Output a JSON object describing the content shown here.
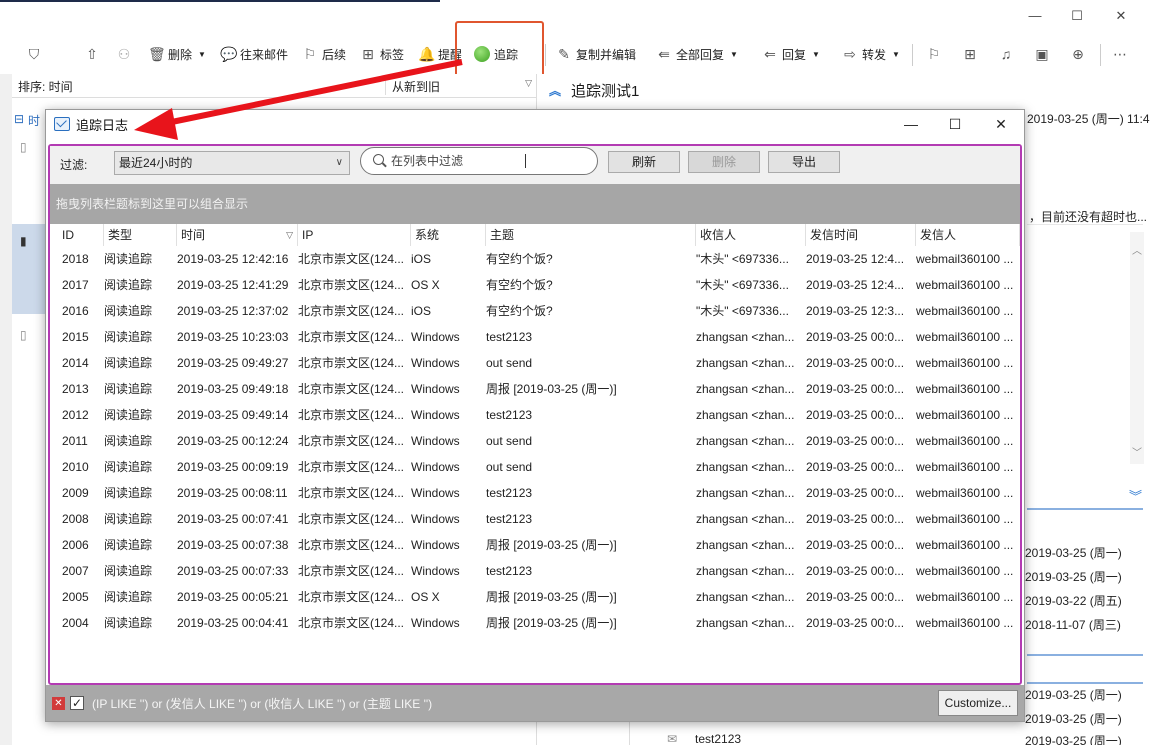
{
  "window": {
    "minimize": "—",
    "maximize": "☐",
    "close": "✕"
  },
  "toolbar": {
    "delete": "删除",
    "correspondence": "往来邮件",
    "followup": "后续",
    "tags": "标签",
    "remind": "提醒",
    "track": "追踪",
    "copy_edit": "复制并编辑",
    "reply_all": "全部回复",
    "reply": "回复",
    "forward": "转发"
  },
  "list": {
    "sort_label": "排序: 时间",
    "order_label": "从新到旧",
    "group_label": "时"
  },
  "preview": {
    "title": "追踪测试1",
    "date": "2019-03-25 (周一) 11:49",
    "snippet": "，目前还没有超时也...",
    "items": [
      {
        "date": "2019-03-25 (周一)"
      },
      {
        "date": "2019-03-25 (周一)"
      },
      {
        "date": "2019-03-22 (周五)"
      },
      {
        "date": "2018-11-07 (周三)"
      }
    ],
    "items2": [
      {
        "date": "2019-03-25 (周一)"
      },
      {
        "date": "2019-03-25 (周一)"
      },
      {
        "date": "2019-03-25 (周一)"
      }
    ],
    "last_subject": "test2123"
  },
  "dialog": {
    "title": "追踪日志",
    "filter_label": "过滤:",
    "range_value": "最近24小时的",
    "search_placeholder": "在列表中过滤",
    "refresh": "刷新",
    "delete": "删除",
    "export": "导出",
    "group_hint": "拖曳列表栏题标到这里可以组合显示",
    "columns": [
      "ID",
      "类型",
      "时间",
      "IP",
      "系统",
      "主题",
      "收信人",
      "发信时间",
      "发信人"
    ],
    "rows": [
      [
        "2018",
        "阅读追踪",
        "2019-03-25 12:42:16",
        "北京市崇文区(124...",
        "iOS",
        "有空约个饭?",
        "\"木头\" <697336...",
        "2019-03-25 12:4...",
        "webmail360100 ..."
      ],
      [
        "2017",
        "阅读追踪",
        "2019-03-25 12:41:29",
        "北京市崇文区(124...",
        "OS X",
        "有空约个饭?",
        "\"木头\" <697336...",
        "2019-03-25 12:4...",
        "webmail360100 ..."
      ],
      [
        "2016",
        "阅读追踪",
        "2019-03-25 12:37:02",
        "北京市崇文区(124...",
        "iOS",
        "有空约个饭?",
        "\"木头\" <697336...",
        "2019-03-25 12:3...",
        "webmail360100 ..."
      ],
      [
        "2015",
        "阅读追踪",
        "2019-03-25 10:23:03",
        "北京市崇文区(124...",
        "Windows",
        "test2123",
        "zhangsan <zhan...",
        "2019-03-25 00:0...",
        "webmail360100 ..."
      ],
      [
        "2014",
        "阅读追踪",
        "2019-03-25 09:49:27",
        "北京市崇文区(124...",
        "Windows",
        "out send",
        "zhangsan <zhan...",
        "2019-03-25 00:0...",
        "webmail360100 ..."
      ],
      [
        "2013",
        "阅读追踪",
        "2019-03-25 09:49:18",
        "北京市崇文区(124...",
        "Windows",
        "周报 [2019-03-25 (周一)]",
        "zhangsan <zhan...",
        "2019-03-25 00:0...",
        "webmail360100 ..."
      ],
      [
        "2012",
        "阅读追踪",
        "2019-03-25 09:49:14",
        "北京市崇文区(124...",
        "Windows",
        "test2123",
        "zhangsan <zhan...",
        "2019-03-25 00:0...",
        "webmail360100 ..."
      ],
      [
        "2011",
        "阅读追踪",
        "2019-03-25 00:12:24",
        "北京市崇文区(124...",
        "Windows",
        "out send",
        "zhangsan <zhan...",
        "2019-03-25 00:0...",
        "webmail360100 ..."
      ],
      [
        "2010",
        "阅读追踪",
        "2019-03-25 00:09:19",
        "北京市崇文区(124...",
        "Windows",
        "out send",
        "zhangsan <zhan...",
        "2019-03-25 00:0...",
        "webmail360100 ..."
      ],
      [
        "2009",
        "阅读追踪",
        "2019-03-25 00:08:11",
        "北京市崇文区(124...",
        "Windows",
        "test2123",
        "zhangsan <zhan...",
        "2019-03-25 00:0...",
        "webmail360100 ..."
      ],
      [
        "2008",
        "阅读追踪",
        "2019-03-25 00:07:41",
        "北京市崇文区(124...",
        "Windows",
        "test2123",
        "zhangsan <zhan...",
        "2019-03-25 00:0...",
        "webmail360100 ..."
      ],
      [
        "2006",
        "阅读追踪",
        "2019-03-25 00:07:38",
        "北京市崇文区(124...",
        "Windows",
        "周报 [2019-03-25 (周一)]",
        "zhangsan <zhan...",
        "2019-03-25 00:0...",
        "webmail360100 ..."
      ],
      [
        "2007",
        "阅读追踪",
        "2019-03-25 00:07:33",
        "北京市崇文区(124...",
        "Windows",
        "test2123",
        "zhangsan <zhan...",
        "2019-03-25 00:0...",
        "webmail360100 ..."
      ],
      [
        "2005",
        "阅读追踪",
        "2019-03-25 00:05:21",
        "北京市崇文区(124...",
        "OS X",
        "周报 [2019-03-25 (周一)]",
        "zhangsan <zhan...",
        "2019-03-25 00:0...",
        "webmail360100 ..."
      ],
      [
        "2004",
        "阅读追踪",
        "2019-03-25 00:04:41",
        "北京市崇文区(124...",
        "Windows",
        "周报 [2019-03-25 (周一)]",
        "zhangsan <zhan...",
        "2019-03-25 00:0...",
        "webmail360100 ..."
      ]
    ],
    "filter_expression": "(IP LIKE '') or (发信人 LIKE '') or (收信人 LIKE '') or (主题 LIKE '')",
    "customize": "Customize...",
    "minimize": "—",
    "maximize": "☐",
    "close": "✕"
  },
  "colors": {
    "highlight": "#e0562f",
    "arrow": "#e8141b",
    "filter_border": "#b33bb3",
    "group_bar": "#a6a6a6"
  }
}
